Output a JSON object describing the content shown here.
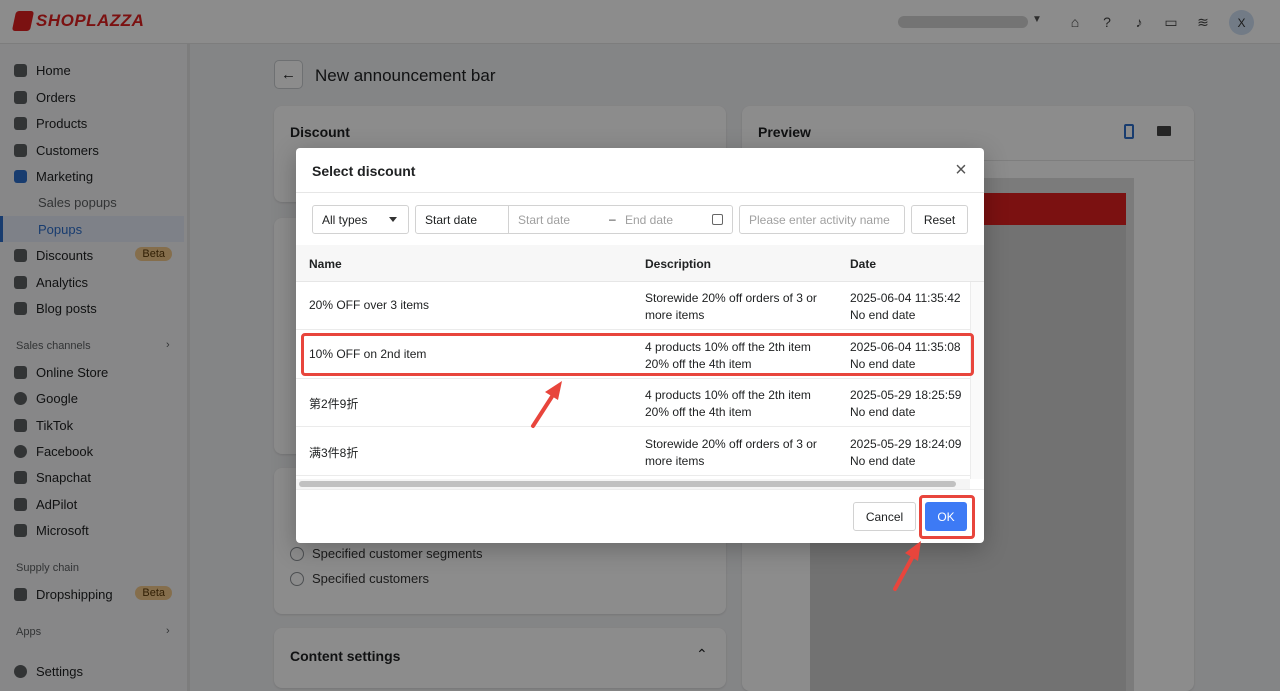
{
  "app": {
    "logo": "SHOPLAZZA",
    "avatar_initial": "X"
  },
  "sidebar": {
    "items": [
      {
        "label": "Home"
      },
      {
        "label": "Orders"
      },
      {
        "label": "Products"
      },
      {
        "label": "Customers"
      },
      {
        "label": "Marketing"
      },
      {
        "label": "Sales popups"
      },
      {
        "label": "Popups"
      },
      {
        "label": "Discounts",
        "badge": "Beta"
      },
      {
        "label": "Analytics"
      },
      {
        "label": "Blog posts"
      }
    ],
    "sales_channels_label": "Sales channels",
    "channels": [
      {
        "label": "Online Store"
      },
      {
        "label": "Google"
      },
      {
        "label": "TikTok"
      },
      {
        "label": "Facebook"
      },
      {
        "label": "Snapchat"
      },
      {
        "label": "AdPilot"
      },
      {
        "label": "Microsoft"
      }
    ],
    "supply_chain_label": "Supply chain",
    "supply_items": [
      {
        "label": "Dropshipping",
        "badge": "Beta"
      }
    ],
    "apps_label": "Apps",
    "settings_label": "Settings"
  },
  "page": {
    "title": "New announcement bar",
    "discount_card_title": "Discount",
    "preview_title": "Preview",
    "radio_options": [
      "Specified customer segments",
      "Specified customers"
    ],
    "content_settings_title": "Content settings"
  },
  "modal": {
    "title": "Select discount",
    "type_select_value": "All types",
    "start_date_label": "Start date",
    "start_date_placeholder": "Start date",
    "end_date_placeholder": "End date",
    "range_separator": "–",
    "name_placeholder": "Please enter activity name",
    "reset_label": "Reset",
    "columns": [
      "Name",
      "Description",
      "Date"
    ],
    "rows": [
      {
        "name": "20% OFF over 3 items",
        "desc1": "Storewide 20% off orders of 3 or",
        "desc2": "more items",
        "date": "2025-06-04 11:35:42",
        "end": "No end date"
      },
      {
        "name": "10% OFF on 2nd item",
        "desc1": "4 products 10% off the 2th item",
        "desc2": "20% off the 4th item",
        "date": "2025-06-04 11:35:08",
        "end": "No end date"
      },
      {
        "name": "第2件9折",
        "desc1": "4 products 10% off the 2th item",
        "desc2": "20% off the 4th item",
        "date": "2025-05-29 18:25:59",
        "end": "No end date"
      },
      {
        "name": "满3件8折",
        "desc1": "Storewide 20% off orders of 3 or",
        "desc2": "more items",
        "date": "2025-05-29 18:24:09",
        "end": "No end date"
      }
    ],
    "cancel_label": "Cancel",
    "ok_label": "OK"
  },
  "colors": {
    "accent": "#3d7af5",
    "annotation": "#e8453c",
    "brand": "#e02020"
  }
}
